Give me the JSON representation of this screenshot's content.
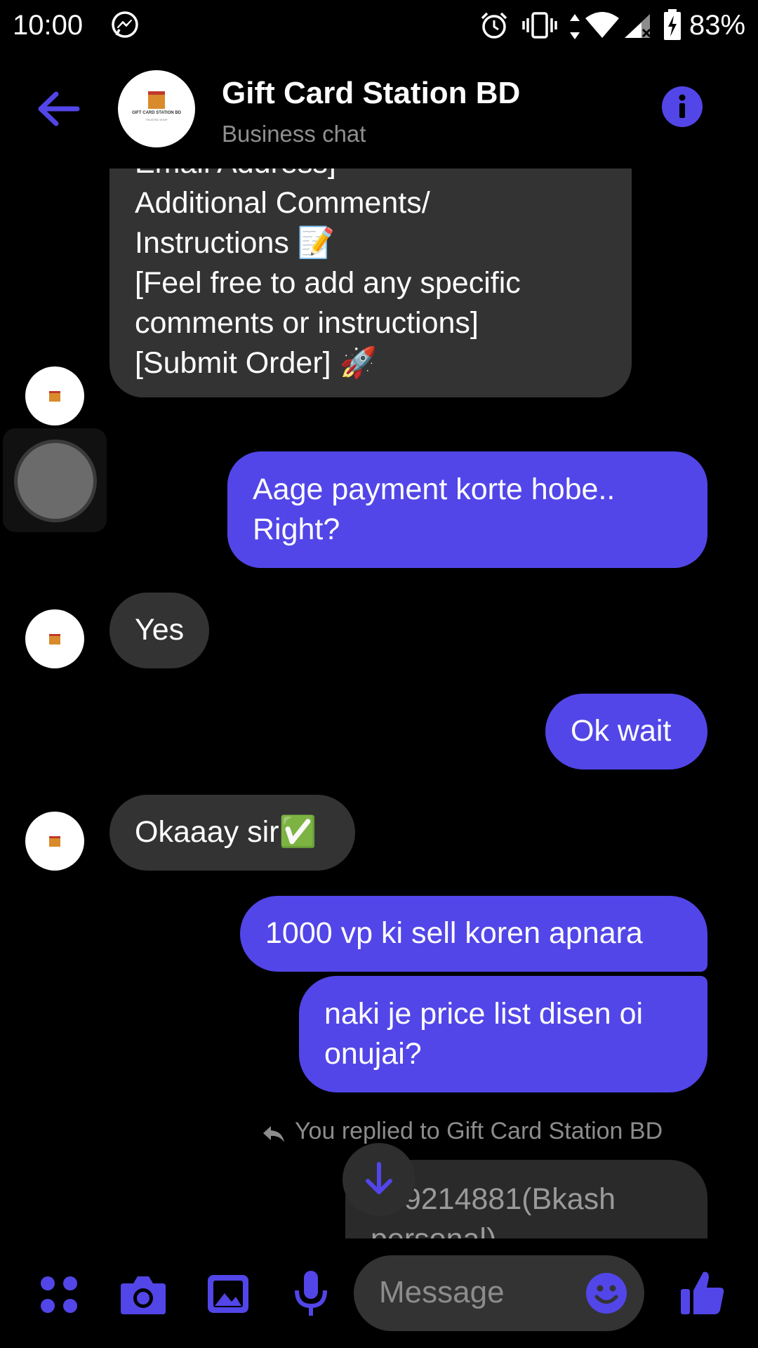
{
  "status_bar": {
    "time": "10:00",
    "battery": "83%",
    "icons": [
      "messenger-icon",
      "alarm-icon",
      "vibrate-icon",
      "data-arrows-icon",
      "wifi-icon",
      "cell-signal-icon",
      "battery-charging-icon"
    ]
  },
  "header": {
    "title": "Gift Card Station BD",
    "subtitle": "Business chat",
    "avatar_text": "GIFT CARD STATION BD",
    "avatar_subtext": "TRUSTED SHOP"
  },
  "messages": {
    "m1": {
      "sender": "incoming",
      "lines": [
        "Email Address]",
        "Additional Comments/",
        "Instructions 📝",
        "[Feel free to add any specific",
        "comments or instructions]",
        "[Submit Order] 🚀"
      ]
    },
    "m2": {
      "sender": "outgoing",
      "lines": [
        "Aage payment korte hobe..",
        "Right?"
      ]
    },
    "m3": {
      "sender": "incoming",
      "lines": [
        "Yes"
      ]
    },
    "m4": {
      "sender": "outgoing",
      "lines": [
        "Ok wait"
      ]
    },
    "m5": {
      "sender": "incoming",
      "lines": [
        "Okaaay sir✅"
      ]
    },
    "m6": {
      "sender": "outgoing",
      "lines": [
        "1000 vp ki sell koren apnara"
      ]
    },
    "m7": {
      "sender": "outgoing",
      "lines": [
        "naki je price list disen oi",
        "onujai?"
      ]
    },
    "reply_label": "You replied to Gift Card Station BD",
    "m8": {
      "sender": "quoted",
      "lines": [
        "969214881(Bkash",
        "personal)"
      ]
    }
  },
  "composer": {
    "placeholder": "Message",
    "icons": [
      "apps-icon",
      "camera-icon",
      "gallery-icon",
      "microphone-icon",
      "emoji-icon",
      "thumbs-up-icon"
    ]
  },
  "colors": {
    "accent": "#5246e8",
    "incoming_bubble": "#333334",
    "outgoing_bubble": "#5246e8",
    "background": "#000000",
    "muted_text": "#8c8c8c"
  }
}
